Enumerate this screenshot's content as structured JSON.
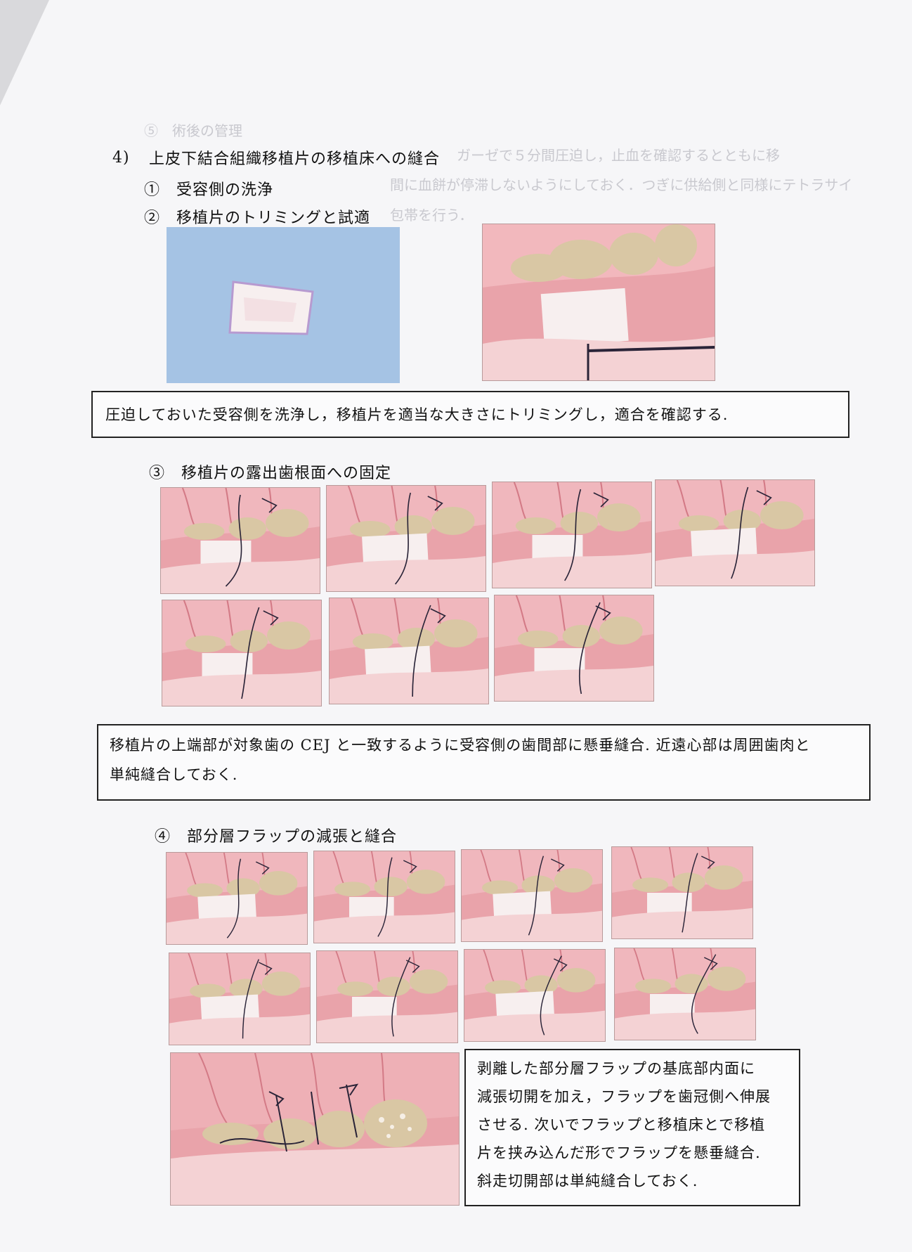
{
  "faint_text": {
    "line1": "⑤　術後の管理",
    "line2": "ガーゼで５分間圧迫し，止血を確認するとともに移",
    "line3": "間に血餅が停滞しないようにしておく．つぎに供給側と同様にテトラサイ",
    "line4": "包帯を行う．"
  },
  "section": {
    "number": "4)",
    "title": "上皮下結合組織移植片の移植床への縫合"
  },
  "steps": {
    "step1": "①　受容側の洗浄",
    "step2": "②　移植片のトリミングと試適",
    "step3": "③　移植片の露出歯根面への固定",
    "step4": "④　部分層フラップの減張と縫合"
  },
  "captions": {
    "caption1": "圧迫しておいた受容側を洗浄し，移植片を適当な大きさにトリミングし，適合を確認する.",
    "caption2_line1": "移植片の上端部が対象歯の CEJ と一致するように受容側の歯間部に懸垂縫合. 近遠心部は周囲歯肉と",
    "caption2_line2": "単純縫合しておく.",
    "caption3_line1": "剥離した部分層フラップの基底部内面に",
    "caption3_line2": "減張切開を加え，フラップを歯冠側へ伸展",
    "caption3_line3": "させる. 次いでフラップと移植床とで移植",
    "caption3_line4": "片を挟み込んだ形でフラップを懸垂縫合.",
    "caption3_line5": "斜走切開部は単純縫合しておく."
  },
  "colors": {
    "gum": "#e9a3aa",
    "gum_dark": "#d37a86",
    "tooth": "#d9c7a4",
    "graft": "#f7efef",
    "drape": "#a9c6e6",
    "suture": "#2a2438"
  }
}
